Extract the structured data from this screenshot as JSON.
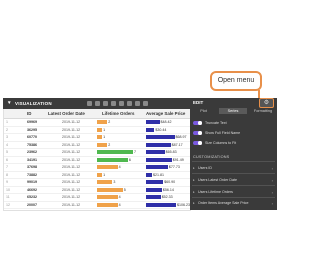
{
  "callout": {
    "text": "Open menu"
  },
  "viz_header": {
    "label": "VISUALIZATION"
  },
  "table": {
    "columns": [
      "ID",
      "Latest Order Date",
      "Lifetime Orders",
      "Average Sale Price"
    ],
    "rows": [
      {
        "n": "1",
        "id": "69969",
        "date": "2019-11-12",
        "orders": 2,
        "orders_label": "2",
        "price_frac": 0.45,
        "price_label": "$48.42"
      },
      {
        "n": "2",
        "id": "36295",
        "date": "2019-11-12",
        "orders": 1,
        "orders_label": "1",
        "price_frac": 0.28,
        "price_label": "$30.44"
      },
      {
        "n": "3",
        "id": "60770",
        "date": "2019-11-12",
        "orders": 1,
        "orders_label": "1",
        "price_frac": 0.95,
        "price_label": "$68.97"
      },
      {
        "n": "4",
        "id": "75386",
        "date": "2019-11-12",
        "orders": 2,
        "orders_label": "2",
        "price_frac": 0.82,
        "price_label": "$87.17"
      },
      {
        "n": "5",
        "id": "23962",
        "date": "2019-11-12",
        "orders": 7,
        "orders_label": "7",
        "price_frac": 0.62,
        "price_label": "$65.83"
      },
      {
        "n": "6",
        "id": "34191",
        "date": "2019-11-12",
        "orders": 6,
        "orders_label": "6",
        "price_frac": 0.86,
        "price_label": "$91.49"
      },
      {
        "n": "7",
        "id": "37698",
        "date": "2019-11-12",
        "orders": 4,
        "orders_label": "4",
        "price_frac": 0.73,
        "price_label": "$77.73"
      },
      {
        "n": "8",
        "id": "73882",
        "date": "2019-11-12",
        "orders": 1,
        "orders_label": "1",
        "price_frac": 0.2,
        "price_label": "$21.81"
      },
      {
        "n": "9",
        "id": "99019",
        "date": "2019-11-12",
        "orders": 3,
        "orders_label": "3",
        "price_frac": 0.57,
        "price_label": "$60.90"
      },
      {
        "n": "10",
        "id": "46692",
        "date": "2019-11-12",
        "orders": 5,
        "orders_label": "5",
        "price_frac": 0.53,
        "price_label": "$56.14"
      },
      {
        "n": "11",
        "id": "65232",
        "date": "2019-11-12",
        "orders": 4,
        "orders_label": "4",
        "price_frac": 0.49,
        "price_label": "$52.33"
      },
      {
        "n": "12",
        "id": "20007",
        "date": "2019-11-12",
        "orders": 4,
        "orders_label": "4",
        "price_frac": 1.0,
        "price_label": "$106.23"
      }
    ],
    "orders_max": 7,
    "colors": {
      "orders_high": "#4fb84f",
      "orders_mid": "#f0a24a",
      "orders_low": "#f0a24a",
      "price": "#2f2fa8"
    }
  },
  "panel": {
    "title": "EDIT",
    "tabs": [
      "Plot",
      "Series",
      "Formatting"
    ],
    "active_tab": 1,
    "toggles": [
      "Truncate Text",
      "Show Full Field Name",
      "Size Columns to Fit"
    ],
    "section_title": "CUSTOMIZATIONS",
    "items": [
      "Users ID",
      "Users Latest Order Date",
      "Users Lifetime Orders",
      "Order Items Average Sale Price"
    ]
  }
}
